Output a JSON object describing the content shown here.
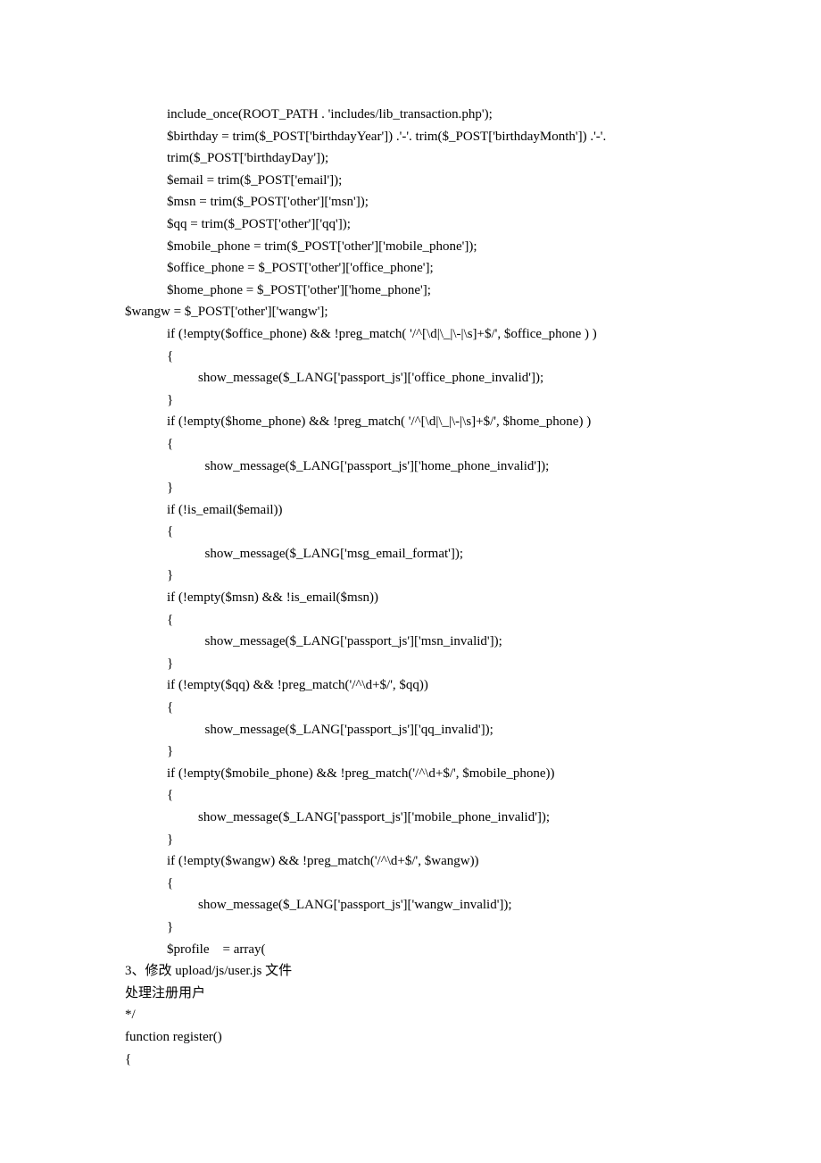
{
  "lines": [
    {
      "cls": "ind1",
      "text": "include_once(ROOT_PATH . 'includes/lib_transaction.php');"
    },
    {
      "cls": "ind1",
      "text": "$birthday = trim($_POST['birthdayYear']) .'-'. trim($_POST['birthdayMonth']) .'-'."
    },
    {
      "cls": "ind1",
      "text": "trim($_POST['birthdayDay']);"
    },
    {
      "cls": "ind1",
      "text": "$email = trim($_POST['email']);"
    },
    {
      "cls": "ind1",
      "text": "$msn = trim($_POST['other']['msn']);"
    },
    {
      "cls": "ind1",
      "text": "$qq = trim($_POST['other']['qq']);"
    },
    {
      "cls": "ind1",
      "text": "$mobile_phone = trim($_POST['other']['mobile_phone']);"
    },
    {
      "cls": "ind1",
      "text": "$office_phone = $_POST['other']['office_phone'];"
    },
    {
      "cls": "ind1",
      "text": "$home_phone = $_POST['other']['home_phone'];"
    },
    {
      "cls": "ind0",
      "text": "$wangw = $_POST['other']['wangw'];"
    },
    {
      "cls": "ind1",
      "text": "if (!empty($office_phone) && !preg_match( '/^[\\d|\\_|\\-|\\s]+$/', $office_phone ) )"
    },
    {
      "cls": "ind1",
      "text": "{"
    },
    {
      "cls": "ind2",
      "text": "show_message($_LANG['passport_js']['office_phone_invalid']);"
    },
    {
      "cls": "ind1",
      "text": "}"
    },
    {
      "cls": "ind1",
      "text": "if (!empty($home_phone) && !preg_match( '/^[\\d|\\_|\\-|\\s]+$/', $home_phone) )"
    },
    {
      "cls": "ind1",
      "text": "{"
    },
    {
      "cls": "ind2",
      "text": "  show_message($_LANG['passport_js']['home_phone_invalid']);"
    },
    {
      "cls": "ind1",
      "text": "}"
    },
    {
      "cls": "ind1",
      "text": "if (!is_email($email))"
    },
    {
      "cls": "ind1",
      "text": "{"
    },
    {
      "cls": "ind2",
      "text": "  show_message($_LANG['msg_email_format']);"
    },
    {
      "cls": "ind1",
      "text": "}"
    },
    {
      "cls": "ind1",
      "text": "if (!empty($msn) && !is_email($msn))"
    },
    {
      "cls": "ind1",
      "text": "{"
    },
    {
      "cls": "ind2",
      "text": "  show_message($_LANG['passport_js']['msn_invalid']);"
    },
    {
      "cls": "ind1",
      "text": "}"
    },
    {
      "cls": "ind1",
      "text": "if (!empty($qq) && !preg_match('/^\\d+$/', $qq))"
    },
    {
      "cls": "ind1",
      "text": "{"
    },
    {
      "cls": "ind2",
      "text": "  show_message($_LANG['passport_js']['qq_invalid']);"
    },
    {
      "cls": "ind1",
      "text": "}"
    },
    {
      "cls": "ind1",
      "text": "if (!empty($mobile_phone) && !preg_match('/^\\d+$/', $mobile_phone))"
    },
    {
      "cls": "ind1",
      "text": "{"
    },
    {
      "cls": "ind2",
      "text": "show_message($_LANG['passport_js']['mobile_phone_invalid']);"
    },
    {
      "cls": "ind1",
      "text": "}"
    },
    {
      "cls": "ind1",
      "text": "if (!empty($wangw) && !preg_match('/^\\d+$/', $wangw))"
    },
    {
      "cls": "ind1",
      "text": "{"
    },
    {
      "cls": "ind2",
      "text": "show_message($_LANG['passport_js']['wangw_invalid']);"
    },
    {
      "cls": "ind1",
      "text": "}"
    },
    {
      "cls": "ind1",
      "text": "$profile    = array("
    },
    {
      "cls": "ind0",
      "text": "3、修改 upload/js/user.js 文件"
    },
    {
      "cls": "ind0",
      "text": "处理注册用户"
    },
    {
      "cls": "ind0",
      "text": "*/"
    },
    {
      "cls": "ind0",
      "text": "function register()"
    },
    {
      "cls": "ind0",
      "text": "{"
    }
  ]
}
